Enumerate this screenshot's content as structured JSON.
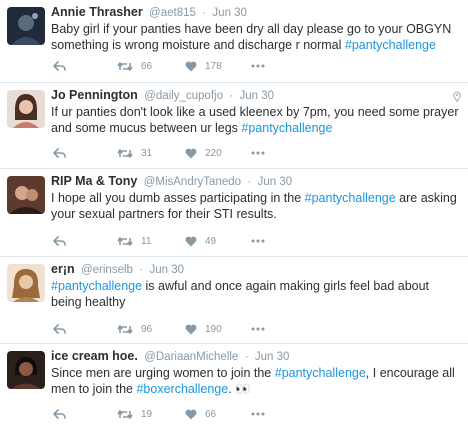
{
  "tweets": [
    {
      "name": "Annie Thrasher",
      "handle": "@aet815",
      "sep": "·",
      "time": "Jun 30",
      "text_before": "Baby girl if your panties have been dry all day please go to your OBGYN something is wrong  moisture and discharge r normal ",
      "hashtag": "#pantychallenge",
      "text_after": "",
      "retweets": "66",
      "likes": "178",
      "avatar_color": "#2d3a4a"
    },
    {
      "name": "Jo Pennington",
      "handle": "@daily_cupofjo",
      "sep": "·",
      "time": "Jun 30",
      "text_before": "If ur panties don't look like a used kleenex by 7pm, you need some prayer and some mucus between ur legs ",
      "hashtag": "#pantychallenge",
      "text_after": "",
      "retweets": "31",
      "likes": "220",
      "avatar_color": "#c9a79a"
    },
    {
      "name": "RIP Ma & Tony",
      "handle": "@MisAndryTanedo",
      "sep": "·",
      "time": "Jun 30",
      "text_before": "I hope all you dumb asses participating in the ",
      "hashtag": "#pantychallenge",
      "text_after": " are asking your sexual partners for their STI results.",
      "retweets": "11",
      "likes": "49",
      "avatar_color": "#6b4a3a"
    },
    {
      "name": "er¡n",
      "handle": "@erinselb",
      "sep": "·",
      "time": "Jun 30",
      "text_before": "",
      "hashtag": "#pantychallenge",
      "text_after": " is awful and once again making girls feel bad about being healthy",
      "retweets": "96",
      "likes": "190",
      "avatar_color": "#b08060"
    },
    {
      "name": "ice cream hoe.",
      "handle": "@DariaanMichelle",
      "sep": "·",
      "time": "Jun 30",
      "text_before": "Since men are urging women to join the ",
      "hashtag": "#pantychallenge",
      "text_mid": ", I encourage all men to join the ",
      "hashtag2": "#boxerchallenge",
      "text_after": ". 👀",
      "retweets": "19",
      "likes": "66",
      "avatar_color": "#3a2a24"
    }
  ],
  "colors": {
    "hashtag": "#1b95e0",
    "meta": "#8899a6",
    "text": "#292f33"
  },
  "icons": {
    "reply": "reply-icon",
    "retweet": "retweet-icon",
    "like": "heart-icon",
    "more": "more-icon",
    "geo": "location-pin-icon"
  }
}
